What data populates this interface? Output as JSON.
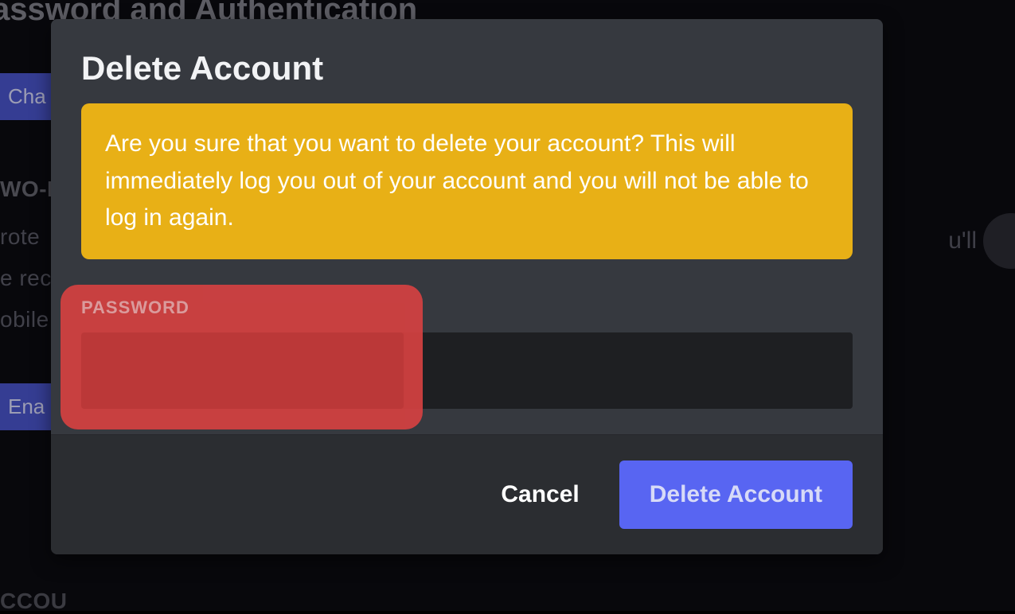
{
  "background": {
    "heading": "assword and Authentication",
    "button_cha": "Cha",
    "label_wof": "WO-F",
    "line1": "rote",
    "line2": "e rec",
    "line3": "obile",
    "right_text": "u'll",
    "button_ena": "Ena",
    "label_acc": "CCOU"
  },
  "modal": {
    "title": "Delete Account",
    "warning": "Are you sure that you want to delete your account? This will immediately log you out of your account and you will not be able to log in again.",
    "password_label": "PASSWORD",
    "password_value": "",
    "cancel_label": "Cancel",
    "delete_label": "Delete Account"
  },
  "annotation": {
    "highlight_color": "#d84141"
  }
}
